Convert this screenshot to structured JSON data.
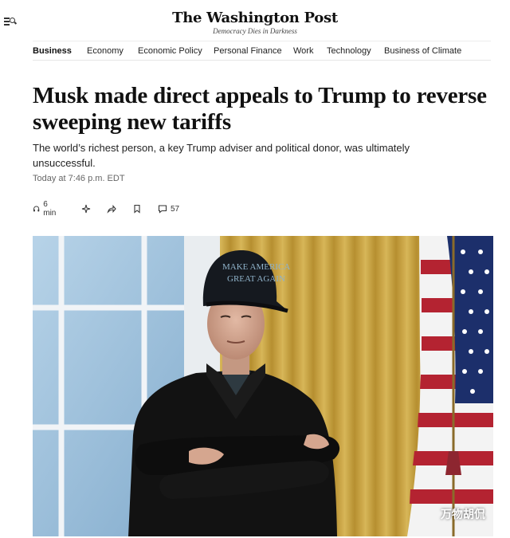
{
  "masthead": {
    "logo": "The Washington Post",
    "tagline": "Democracy Dies in Darkness"
  },
  "nav": {
    "items": [
      "Business",
      "Economy",
      "Economic Policy",
      "Personal Finance",
      "Work",
      "Technology",
      "Business of Climate"
    ]
  },
  "article": {
    "headline": "Musk made direct appeals to Trump to reverse sweeping new tariffs",
    "dek": "The world’s richest person, a key Trump adviser and political donor, was ultimately unsuccessful.",
    "timestamp": "Today at 7:46 p.m. EDT"
  },
  "toolbar": {
    "listen_label": "6 min",
    "comment_count": "57",
    "icons": [
      "headphones-icon",
      "sparkle-icon",
      "share-icon",
      "bookmark-icon",
      "comment-icon"
    ]
  },
  "photo": {
    "hat_text": "MAKE AMERICA GREAT AGAIN",
    "colors": {
      "window_glass": "#9ec2dd",
      "curtain_gold": "#c9a447",
      "flag_blue": "#1c2f6b",
      "flag_red": "#b42331",
      "coat": "#121212"
    }
  },
  "watermark": "万物胡侃"
}
